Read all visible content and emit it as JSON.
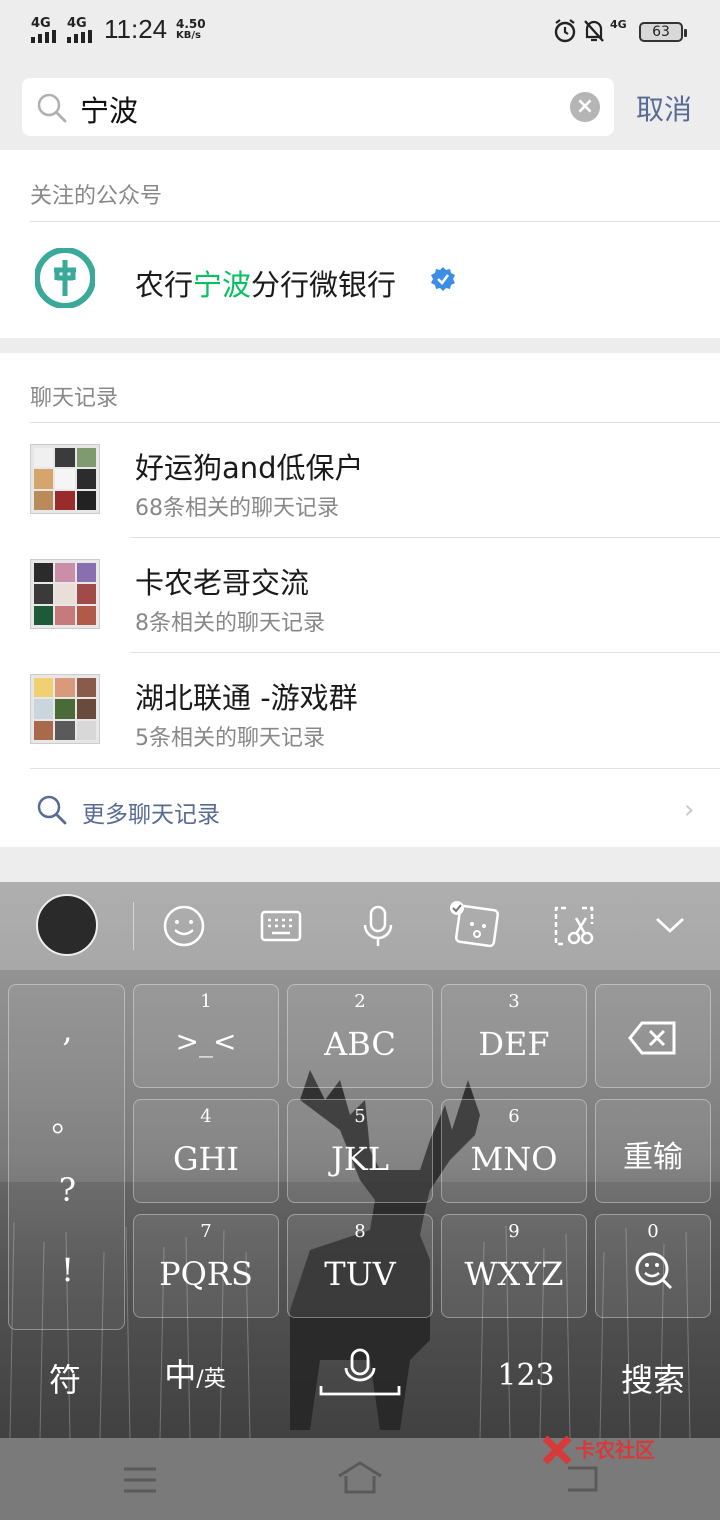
{
  "status_bar": {
    "signal1": "4G",
    "signal2": "4G",
    "time": "11:24",
    "speed_value": "4.50",
    "speed_unit": "KB/s",
    "network": "4G",
    "battery": "63"
  },
  "search": {
    "query": "宁波",
    "cancel_label": "取消"
  },
  "accounts": {
    "header": "关注的公众号",
    "item": {
      "name_prefix": "农行",
      "name_highlight": "宁波",
      "name_suffix": "分行微银行"
    }
  },
  "chats": {
    "header": "聊天记录",
    "items": [
      {
        "title": "好运狗and低保户",
        "subtitle": "68条相关的聊天记录"
      },
      {
        "title": "卡农老哥交流",
        "subtitle": "8条相关的聊天记录"
      },
      {
        "title": "湖北联通 -游戏群",
        "subtitle": "5条相关的聊天记录"
      }
    ],
    "more_label": "更多聊天记录"
  },
  "keyboard": {
    "punct": [
      ",",
      "。",
      "?",
      "!"
    ],
    "keys": [
      {
        "num": "1",
        "label": ">_<"
      },
      {
        "num": "2",
        "label": "ABC"
      },
      {
        "num": "3",
        "label": "DEF"
      },
      {
        "num": "4",
        "label": "GHI"
      },
      {
        "num": "5",
        "label": "JKL"
      },
      {
        "num": "6",
        "label": "MNO"
      },
      {
        "num": "7",
        "label": "PQRS"
      },
      {
        "num": "8",
        "label": "TUV"
      },
      {
        "num": "9",
        "label": "WXYZ"
      },
      {
        "num": "0",
        "label": ""
      }
    ],
    "retype_label": "重输",
    "symbols_label": "符",
    "lang_main": "中",
    "lang_sub": "/英",
    "numbers_label": "123",
    "search_label": "搜索"
  },
  "watermark": "卡农社区",
  "colors": {
    "highlight": "#07c160",
    "link": "#576b95",
    "verified": "#3a8ee6"
  }
}
